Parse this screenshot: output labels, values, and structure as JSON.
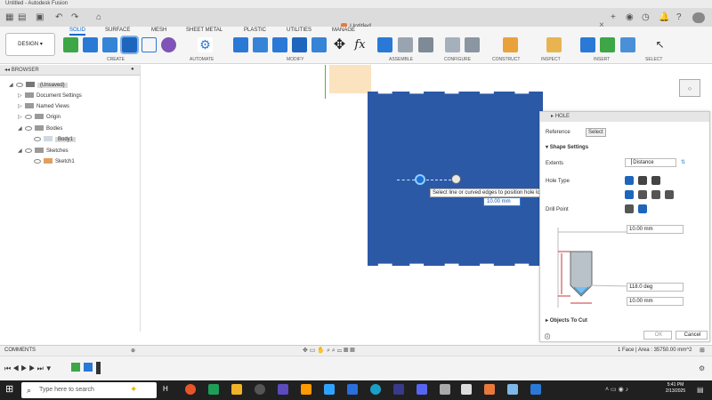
{
  "window": {
    "title": "Untitled - Autodesk Fusion"
  },
  "document_tab": {
    "label": "Untitled"
  },
  "toolbar": {
    "workspace": "DESIGN",
    "tabs": [
      "SOLID",
      "SURFACE",
      "MESH",
      "SHEET METAL",
      "PLASTIC",
      "UTILITIES",
      "MANAGE"
    ],
    "active_tab": "SOLID",
    "groups": [
      "CREATE",
      "AUTOMATE",
      "MODIFY",
      "ASSEMBLE",
      "CONFIGURE",
      "CONSTRUCT",
      "INSPECT",
      "INSERT",
      "SELECT"
    ]
  },
  "browser": {
    "header": "BROWSER",
    "nodes": [
      "(Unsaved)",
      "Document Settings",
      "Named Views",
      "Origin",
      "Bodies",
      "Body1",
      "Sketches",
      "Sketch1"
    ]
  },
  "viewport": {
    "tooltip": "Select line or curved edges to position hole location",
    "value_input": "10.00 mm"
  },
  "hole_dialog": {
    "title": "HOLE",
    "tabs": [
      "Reference",
      "Select"
    ],
    "section_shape": "Shape Settings",
    "rows": [
      "Extents",
      "Hole Type",
      "Drill Point"
    ],
    "extents_value": "Distance",
    "dim_depth": "10.00 mm",
    "dim_angle": "118.0 deg",
    "dim_diameter": "10.00 mm",
    "section_objects": "Objects To Cut",
    "ok": "OK",
    "cancel": "Cancel"
  },
  "status": {
    "comments": "COMMENTS",
    "measure": "1 Face | Area : 35750.00 mm^2"
  },
  "taskbar": {
    "search_placeholder": "Type here to search",
    "time": "5:41 PM",
    "date": "2/13/2025"
  },
  "colors": {
    "accent": "#0a6ad0",
    "body": "#2c59a6",
    "peach": "#fbe3c0"
  }
}
